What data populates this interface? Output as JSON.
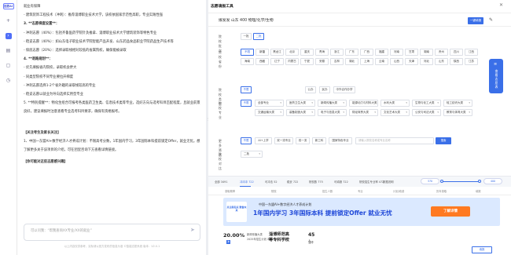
{
  "rail": {
    "logo": "志愿AI",
    "items": [
      "plus-icon",
      "chevron-right-icon",
      "document-icon",
      "file-icon",
      "history-icon"
    ]
  },
  "chat": {
    "lines": [
      "就业有保障",
      "- 建筑装饰工程技术（冲刺）：推荐淄博职业技术大学，该校依国家示范性高职，专业实践性强",
      "3. **志愿梯度设置**：",
      "- 冲刺志愿（40%）：包括齐鲁医药学院针灸推拿、淄博职业技术大学建筑装饰等特色专业",
      "- 稳妥志愿（40%）：如山东电子职业技术学院智能产品开发、山东药品食品职业学院药品生产技术等",
      "- 保底志愿（20%）：选择录取线相对较低的省属院校，确保能被录取",
      "4. **退路规划**：",
      "- 优先填报省内院校，录取机会更大",
      "- 同类型院校不同专业要拉开梯度",
      "- 冲刺志愿选择1-2个省外趣的录取线较高的专业",
      "- 稳妥志愿以就业为导向选择实用型专业",
      "5. **特别提醒**：物化生组合可报考各类医药卫生类、信息技术类等专业，选好方向与选考科目匹配程度，且就业前景良好。建议填报时注意查看专业选考科目要求，确保有资格报考。",
      "【关注考生及家长关注】",
      "1、中国一东盟AI+数字经济人才养成计划：不限高考分数，1年国内学习，3年国际本科提前锁定Offer，就业无忧。想了解更多关于该项目的介绍，可在团里咨询下方查看详情链接。",
      "【你可能对这些志愿感兴趣】"
    ],
    "input_placeholder": "可以问我：“帮我查询XX专业/XX的就业”",
    "disclaimer": "以上内容仅供参考，实际请以官方发布的信息为准 ©智能志愿系统 版本：V2.0.1"
  },
  "panel": {
    "title": "志愿填报工具",
    "header_text": "拨发发   山东   400   物理/化学/生物",
    "one_click": "一键填报",
    "batch": {
      "label": "院校批次",
      "options": [
        "一批",
        "二批"
      ],
      "selected": 1
    },
    "region": {
      "label": "院校省份",
      "options": [
        "不限",
        "新疆",
        "黑龙江",
        "北京",
        "重庆",
        "青海",
        "浙江",
        "广东",
        "广西",
        "福建",
        "河南",
        "甘肃",
        "湖南",
        "贵州",
        "四川",
        "江西",
        "海南",
        "西藏",
        "辽宁",
        "内蒙古",
        "宁夏",
        "安徽",
        "吉林",
        "湖北",
        "上海",
        "云南",
        "山西",
        "天津",
        "河北",
        "山东",
        "陕西",
        "江苏"
      ],
      "selected": 0
    },
    "school_type": {
      "label": "院校类型",
      "options": [
        "不限",
        "公办",
        "民办",
        "中外合作办学"
      ],
      "selected": 0
    },
    "dept": {
      "label": "院校专业",
      "options": [
        "不限",
        "全部专业",
        "医药卫生大类",
        "新闻传播大类",
        "能源动力与材料大类",
        "水利大类",
        "生物与化工大类",
        "轻工纺织大类",
        "交通运输大类",
        "装备制造大类",
        "电子与信息大类",
        "财经商贸大类",
        "文化艺术大类",
        "公安与司法大类",
        "教育与体育大类"
      ],
      "selected": 0
    },
    "tags": {
      "label": "更多筛选",
      "options": [
        "不限",
        "AI+上学",
        "双一流专业",
        "双一流",
        "新工科",
        "国家特色专业"
      ],
      "selected": 0
    },
    "search": {
      "placeholder": "请输入院校名称或专业名称",
      "button": "搜索"
    },
    "compare": {
      "label": "院校对比",
      "value": "二批"
    },
    "float": {
      "label": "查看志愿表"
    },
    "tabs": [
      "全部 3491",
      "冲冲冲 722",
      "可冲击 52",
      "稳妥 722",
      "院校数 775",
      "可填报 722",
      "院校招生专业率 472"
    ],
    "data_label": "数据说明",
    "min": "370",
    "max": "400",
    "columns": [
      "录取概率",
      "院校",
      "招生人数",
      "专业",
      "计划/收费",
      "历年录取",
      "填报"
    ],
    "banner": {
      "card": "关注新起点 数智未来",
      "line1": "中国一东盟AI+数字经济人才养成计划",
      "line2": "1年国内学习 3年国际本科 提前锁定Offer 就业无忧",
      "button": "了解详情"
    },
    "row": {
      "prob": "20.00",
      "prob_unit": "%",
      "badge": "冲",
      "info1": "新闻传播大类",
      "info2": "2025年招生计划 本科",
      "university": "淄博师范高等专科学校",
      "count": "45",
      "count_unit": "人",
      "city": "淄博",
      "btn": "填报"
    }
  }
}
